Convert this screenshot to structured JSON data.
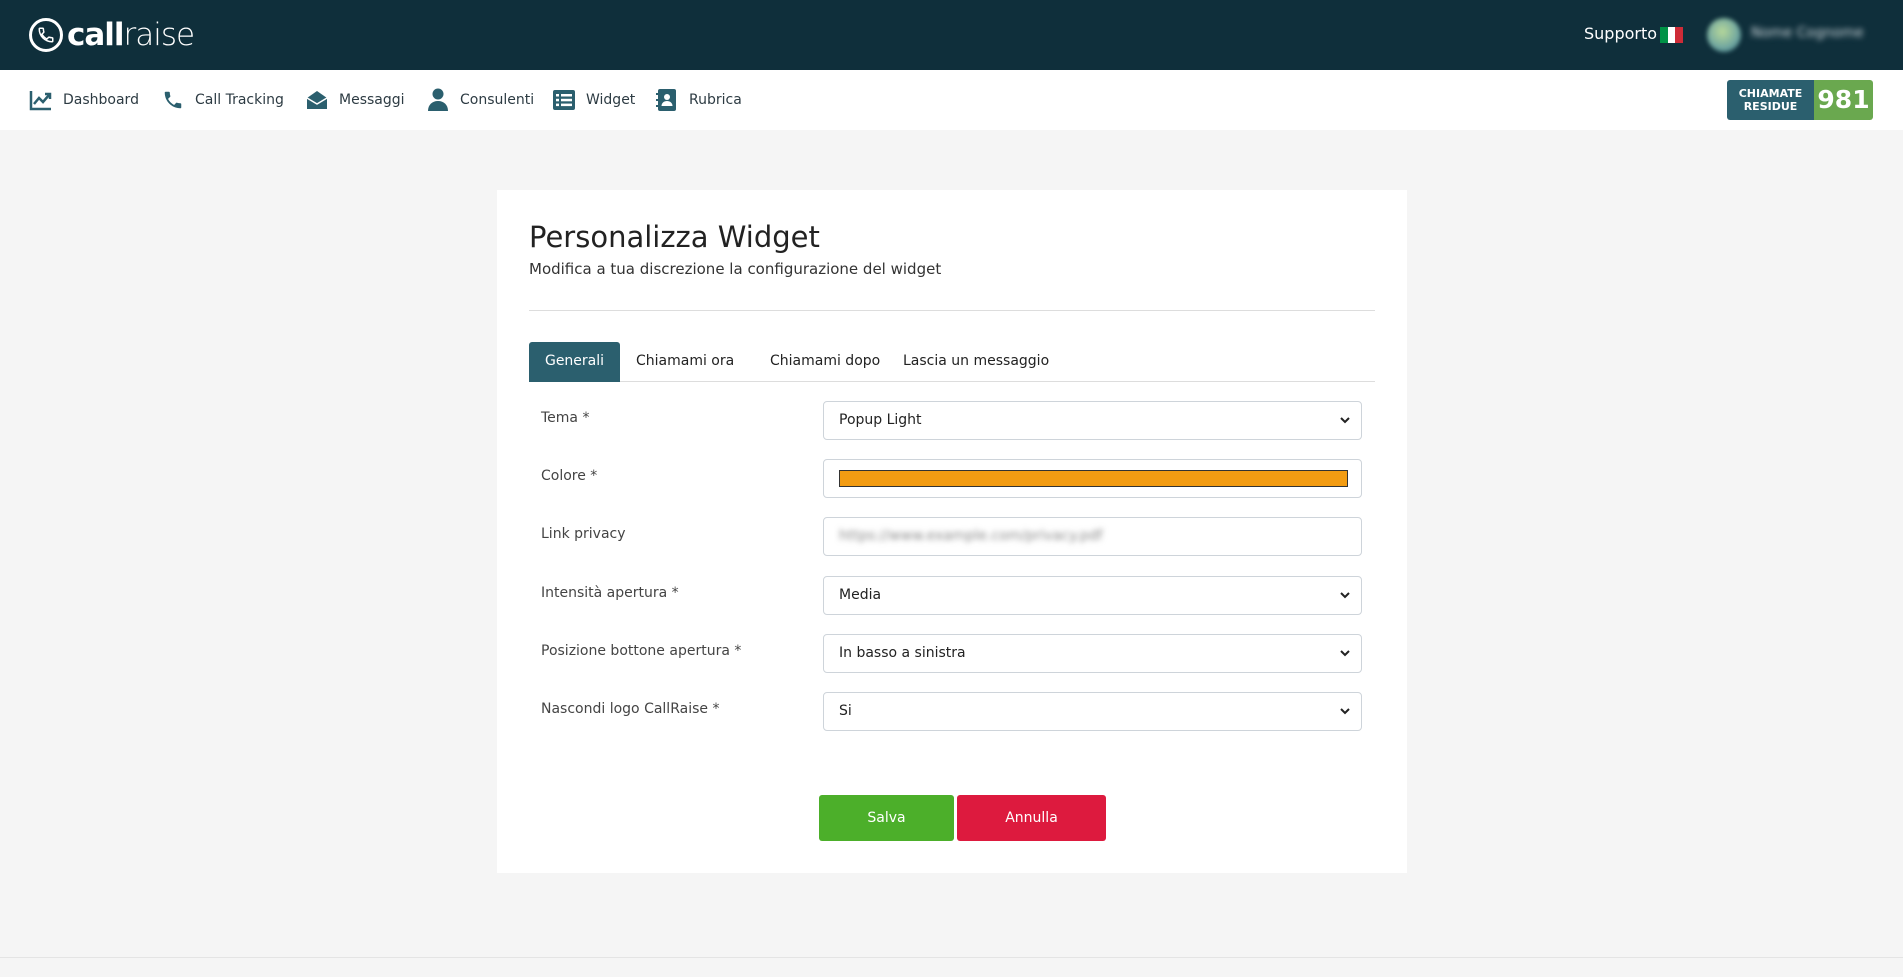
{
  "header": {
    "brand": {
      "bold": "call",
      "thin": "raise"
    },
    "support_label": "Supporto",
    "flag_colors": [
      "#009246",
      "#ffffff",
      "#ce2b37"
    ],
    "user_name": "Nome Cognome"
  },
  "nav": {
    "items": [
      {
        "label": "Dashboard",
        "icon": "chart-line-icon"
      },
      {
        "label": "Call Tracking",
        "icon": "phone-icon"
      },
      {
        "label": "Messaggi",
        "icon": "envelope-open-icon"
      },
      {
        "label": "Consulenti",
        "icon": "user-icon"
      },
      {
        "label": "Widget",
        "icon": "list-alt-icon"
      },
      {
        "label": "Rubrica",
        "icon": "address-book-icon"
      }
    ],
    "credits_label_1": "CHIAMATE",
    "credits_label_2": "RESIDUE",
    "credits_value": "981"
  },
  "page": {
    "title": "Personalizza Widget",
    "subtitle": "Modifica a tua discrezione la configurazione del widget"
  },
  "tabs": [
    "Generali",
    "Chiamami ora",
    "Chiamami dopo",
    "Lascia un messaggio"
  ],
  "active_tab": "Generali",
  "form": {
    "tema": {
      "label": "Tema *",
      "value": "Popup Light"
    },
    "colore": {
      "label": "Colore *",
      "value": "#f39c12"
    },
    "privacy": {
      "label": "Link privacy",
      "value": "https://www.example.com/privacy.pdf"
    },
    "intensita": {
      "label": "Intensità apertura *",
      "value": "Media"
    },
    "posizione": {
      "label": "Posizione bottone apertura *",
      "value": "In basso a sinistra"
    },
    "nascondi": {
      "label": "Nascondi logo CallRaise *",
      "value": "Si"
    }
  },
  "buttons": {
    "save": "Salva",
    "cancel": "Annulla"
  },
  "colors": {
    "topbar": "#0f2f3b",
    "accent": "#2b5f6e",
    "save": "#4caf2a",
    "cancel": "#dd1a3e",
    "credits_value_bg": "#6aa84f"
  }
}
